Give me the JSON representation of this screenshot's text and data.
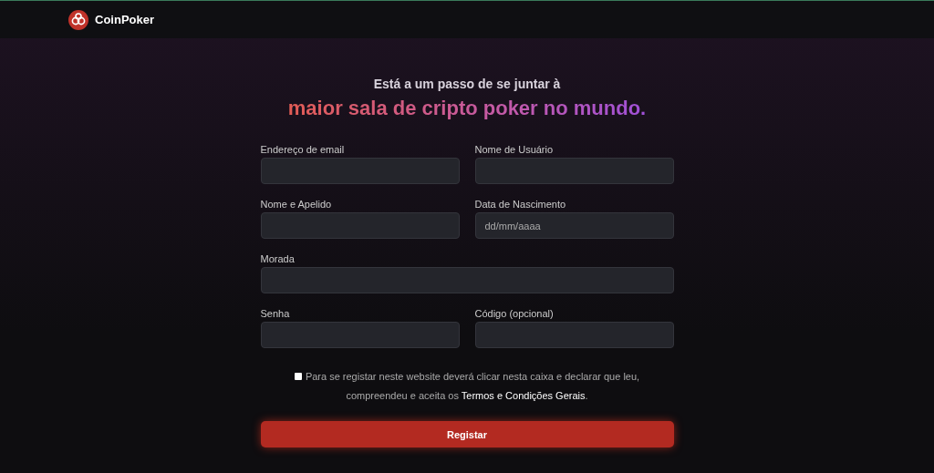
{
  "header": {
    "logo_text": "CoinPoker"
  },
  "heading": {
    "intro": "Está a um passo de se juntar à",
    "highlight": "maior sala de cripto poker no mundo."
  },
  "fields": [
    {
      "label": "Endereço de email",
      "kind": "half"
    },
    {
      "label": "Nome de Usuário",
      "kind": "half"
    },
    {
      "label": "Nome e Apelido",
      "kind": "half"
    },
    {
      "label": "Data de Nascimento",
      "placeholder": "dd/mm/aaaa",
      "kind": "half"
    },
    {
      "label": "Morada",
      "kind": "wide"
    },
    {
      "label": "Senha",
      "kind": "half"
    },
    {
      "label": "Código (opcional)",
      "kind": "half"
    }
  ],
  "consent": {
    "checked": false,
    "text": "Para se registar neste website deverá clicar nesta caixa e declarar que leu, compreendeu e aceita os ",
    "link": "Termos e Condições Gerais",
    "after": "."
  },
  "submit": {
    "label": "Registar"
  }
}
